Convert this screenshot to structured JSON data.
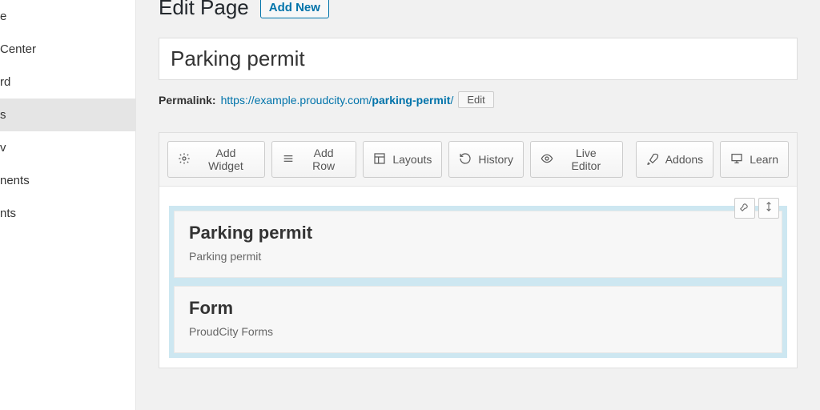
{
  "sidebar": {
    "items": [
      {
        "label": "e"
      },
      {
        "label": "Center"
      },
      {
        "label": "rd"
      },
      {
        "label": "s"
      },
      {
        "label": "v"
      },
      {
        "label": "nents"
      },
      {
        "label": "nts"
      }
    ],
    "activeIndex": 3
  },
  "header": {
    "title": "Edit Page",
    "add_new": "Add New"
  },
  "page_title_input": "Parking permit",
  "permalink": {
    "label": "Permalink:",
    "base": "https://example.proudcity.com/",
    "slug": "parking-permit",
    "trail": "/",
    "edit": "Edit"
  },
  "toolbar": {
    "add_widget": "Add Widget",
    "add_row": "Add Row",
    "layouts": "Layouts",
    "history": "History",
    "live_editor": "Live Editor",
    "addons": "Addons",
    "learn": "Learn"
  },
  "widgets": [
    {
      "title": "Parking permit",
      "subtitle": "Parking permit"
    },
    {
      "title": "Form",
      "subtitle": "ProudCity Forms"
    }
  ]
}
